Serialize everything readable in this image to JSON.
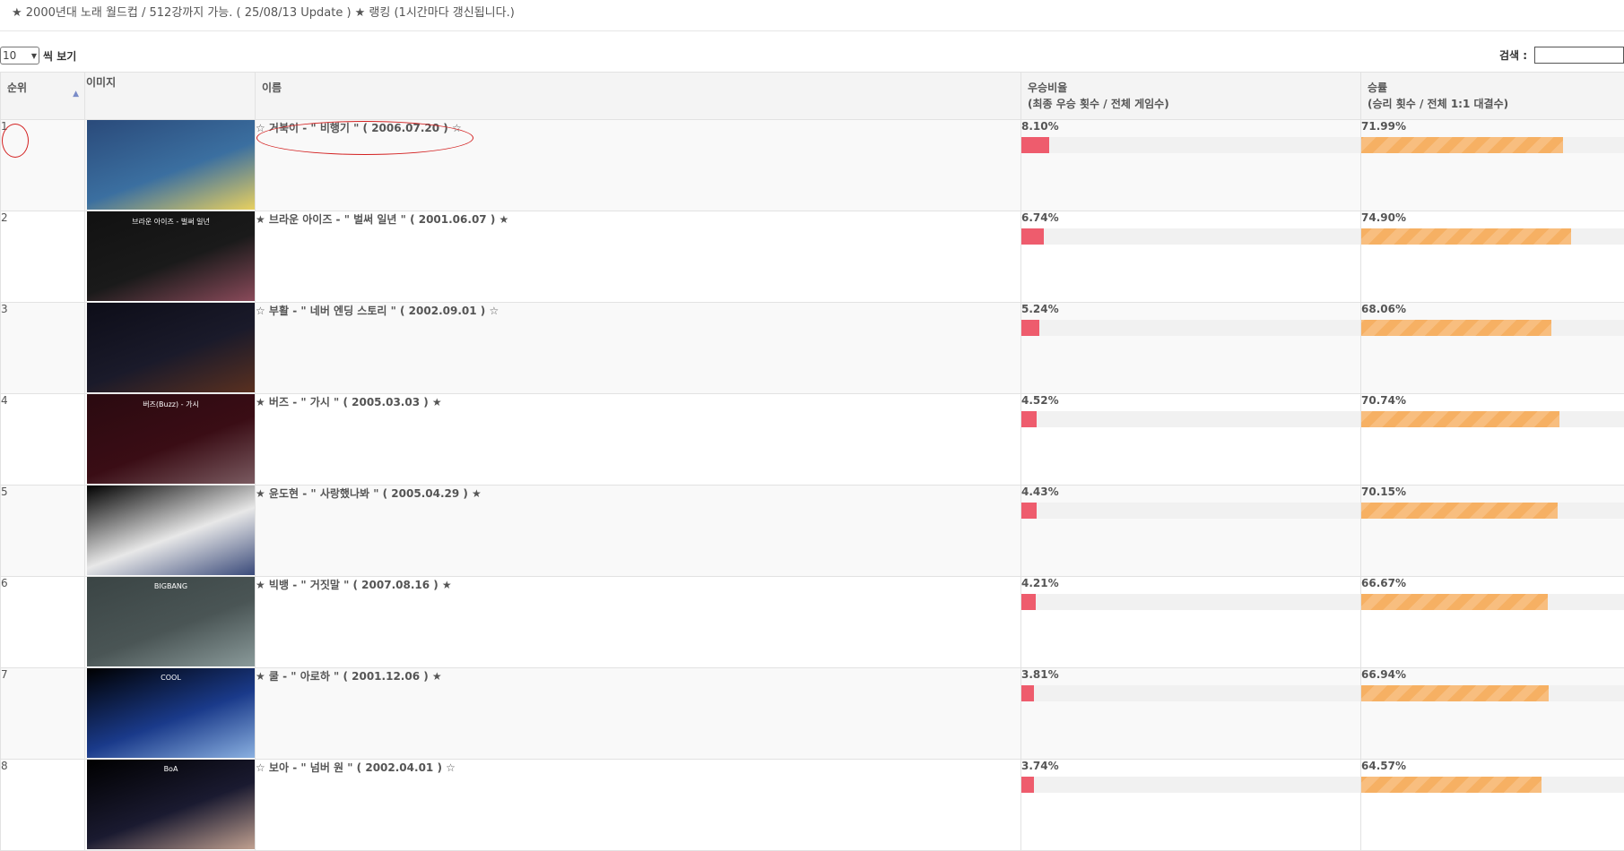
{
  "header": {
    "title": "★ 2000년대 노래 월드컵 / 512강까지 가능. ( 25/08/13 Update ) ★ 랭킹 (1시간마다 갱신됩니다.)"
  },
  "controls": {
    "length_value": "10",
    "length_label": "씩 보기",
    "search_label": "검색 :",
    "search_value": ""
  },
  "table": {
    "columns": {
      "rank": "순위",
      "image": "이미지",
      "name": "이름",
      "win_ratio": "우승비율",
      "win_ratio_sub": "(최종 우승 횟수 / 전체 게임수)",
      "win_rate": "승률",
      "win_rate_sub": "(승리 횟수 / 전체 1:1 대결수)"
    },
    "rows": [
      {
        "rank": "1",
        "name": "☆ 거북이 - \" 비행기 \" ( 2006.07.20 ) ☆",
        "win_ratio": "8.10%",
        "win_ratio_value": 8.1,
        "win_rate": "71.99%",
        "win_rate_value": 71.99,
        "thumb_text": "",
        "thumb_colors": [
          "#2a4a7a",
          "#3b6fa0",
          "#e8d060"
        ]
      },
      {
        "rank": "2",
        "name": "★ 브라운 아이즈 - \" 벌써 일년 \" ( 2001.06.07 ) ★",
        "win_ratio": "6.74%",
        "win_ratio_value": 6.74,
        "win_rate": "74.90%",
        "win_rate_value": 74.9,
        "thumb_text": "브라운 아이즈 - 벌써 일년",
        "thumb_colors": [
          "#111111",
          "#1a1a1a",
          "#8a4a5a"
        ]
      },
      {
        "rank": "3",
        "name": "☆ 부활 - \" 네버 엔딩 스토리 \" ( 2002.09.01 ) ☆",
        "win_ratio": "5.24%",
        "win_ratio_value": 5.24,
        "win_rate": "68.06%",
        "win_rate_value": 68.06,
        "thumb_text": "",
        "thumb_colors": [
          "#0d0d18",
          "#1a1a2a",
          "#5a3020"
        ]
      },
      {
        "rank": "4",
        "name": "★ 버즈 - \" 가시 \" ( 2005.03.03 ) ★",
        "win_ratio": "4.52%",
        "win_ratio_value": 4.52,
        "win_rate": "70.74%",
        "win_rate_value": 70.74,
        "thumb_text": "버즈(Buzz) - 가시",
        "thumb_colors": [
          "#2a0a10",
          "#3a0d15",
          "#7a5a60"
        ]
      },
      {
        "rank": "5",
        "name": "★ 윤도현 - \" 사랑했나봐 \" ( 2005.04.29 ) ★",
        "win_ratio": "4.43%",
        "win_ratio_value": 4.43,
        "win_rate": "70.15%",
        "win_rate_value": 70.15,
        "thumb_text": "",
        "thumb_colors": [
          "#000000",
          "#e8e8e8",
          "#3a4a7a"
        ]
      },
      {
        "rank": "6",
        "name": "★ 빅뱅 - \" 거짓말 \" ( 2007.08.16 ) ★",
        "win_ratio": "4.21%",
        "win_ratio_value": 4.21,
        "win_rate": "66.67%",
        "win_rate_value": 66.67,
        "thumb_text": "BIGBANG",
        "thumb_colors": [
          "#3a4444",
          "#4a5555",
          "#8a9a9a"
        ]
      },
      {
        "rank": "7",
        "name": "★ 쿨 - \" 아로하 \" ( 2001.12.06 ) ★",
        "win_ratio": "3.81%",
        "win_ratio_value": 3.81,
        "win_rate": "66.94%",
        "win_rate_value": 66.94,
        "thumb_text": "COOL",
        "thumb_colors": [
          "#000000",
          "#1a3a8a",
          "#8ab0e0"
        ]
      },
      {
        "rank": "8",
        "name": "☆ 보아 - \" 넘버 원 \" ( 2002.04.01 ) ☆",
        "win_ratio": "3.74%",
        "win_ratio_value": 3.74,
        "win_rate": "64.57%",
        "win_rate_value": 64.57,
        "thumb_text": "BoA",
        "thumb_colors": [
          "#000000",
          "#1a1a30",
          "#c0a090"
        ]
      }
    ]
  },
  "colors": {
    "win_ratio_bar": "#ee5c6d",
    "win_rate_bar": "#f6b063",
    "highlight_annotation": "#d32020"
  },
  "icons": {
    "sort": "sort-ascending-icon"
  }
}
